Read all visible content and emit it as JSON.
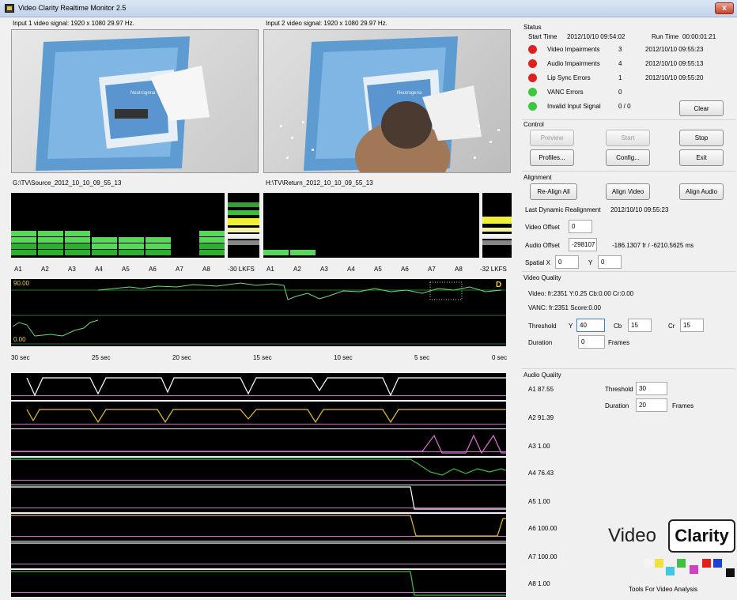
{
  "window": {
    "title": "Video Clarity Realtime Monitor 2.5",
    "close_glyph": "x"
  },
  "inputs": [
    {
      "signal_label": "Input 1 video signal: 1920 x 1080 29.97 Hz.",
      "file_path": "G:\\TV\\Source_2012_10_10_09_55_13",
      "product_text": "Neutrogena"
    },
    {
      "signal_label": "Input 2 video signal: 1920 x 1080 29.97 Hz.",
      "file_path": "H:\\TV\\Return_2012_10_10_09_55_13",
      "product_text": "Neutrogena"
    }
  ],
  "audio_meters": [
    {
      "channels": [
        "A1",
        "A2",
        "A3",
        "A4",
        "A5",
        "A6",
        "A7",
        "A8"
      ],
      "lkfs": "-30 LKFS",
      "levels": [
        0.43,
        0.43,
        0.48,
        0.35,
        0.38,
        0.33,
        0,
        0.48
      ]
    },
    {
      "channels": [
        "A1",
        "A2",
        "A3",
        "A4",
        "A5",
        "A6",
        "A7",
        "A8"
      ],
      "lkfs": "-32 LKFS",
      "levels": [
        0.07,
        0.07,
        0,
        0,
        0,
        0,
        0,
        0
      ]
    }
  ],
  "video_graph": {
    "top_value": "90.00",
    "bottom_value": "0.00",
    "marker": "D",
    "time_ticks": [
      "30 sec",
      "25 sec",
      "20 sec",
      "15 sec",
      "10 sec",
      "5 sec",
      "0 sec"
    ]
  },
  "status": {
    "heading": "Status",
    "start_time_label": "Start Time",
    "start_time_value": "2012/10/10 09:54:02",
    "run_time_label": "Run Time",
    "run_time_value": "00:00:01:21",
    "rows": [
      {
        "label": "Video Impairments",
        "count": "3",
        "time": "2012/10/10 09:55:23",
        "color": "#e02020"
      },
      {
        "label": "Audio Impairments",
        "count": "4",
        "time": "2012/10/10 09:55:13",
        "color": "#e02020"
      },
      {
        "label": "Lip Sync Errors",
        "count": "1",
        "time": "2012/10/10 09:55:20",
        "color": "#e02020"
      },
      {
        "label": "VANC Errors",
        "count": "0",
        "time": "",
        "color": "#3cc83c"
      },
      {
        "label": "Invalid Input Signal",
        "count": "0 / 0",
        "time": "",
        "color": "#3cc83c"
      }
    ],
    "clear_button": "Clear"
  },
  "control": {
    "heading": "Control",
    "preview": "Preview",
    "start": "Start",
    "stop": "Stop",
    "profiles": "Profiles...",
    "config": "Config...",
    "exit": "Exit"
  },
  "alignment": {
    "heading": "Alignment",
    "realign_all": "Re-Align All",
    "align_video": "Align Video",
    "align_audio": "Align Audio",
    "last_realign_label": "Last Dynamic Realignment",
    "last_realign_value": "2012/10/10 09:55:23",
    "video_offset_label": "Video Offset",
    "video_offset_value": "0",
    "audio_offset_label": "Audio Offset",
    "audio_offset_value": "-298107",
    "audio_offset_info": "-186.1307 fr / -6210.5625 ms",
    "spatial_x_label": "Spatial X",
    "spatial_x_value": "0",
    "y_label": "Y",
    "y_value": "0"
  },
  "video_quality": {
    "heading": "Video Quality",
    "video_line": "Video: fr:2351 Y:0.25 Cb:0.00 Cr:0.00",
    "vanc_line": "VANC: fr:2351 Score:0.00",
    "threshold_label": "Threshold",
    "y_label": "Y",
    "y_value": "40",
    "cb_label": "Cb",
    "cb_value": "15",
    "cr_label": "Cr",
    "cr_value": "15",
    "duration_label": "Duration",
    "duration_value": "0",
    "frames_label": "Frames"
  },
  "audio_quality": {
    "heading": "Audio Quality",
    "threshold_label": "Threshold",
    "threshold_value": "30",
    "duration_label": "Duration",
    "duration_value": "20",
    "frames_label": "Frames",
    "channels": [
      {
        "label": "A1 87.55",
        "color": "#ffffff"
      },
      {
        "label": "A2 91.39",
        "color": "#e8c020"
      },
      {
        "label": "A3 1.00",
        "color": "#e070d8"
      },
      {
        "label": "A4 76.43",
        "color": "#40c040"
      },
      {
        "label": "A5 1.00",
        "color": "#ffffff"
      },
      {
        "label": "A6 100.00",
        "color": "#e8c020"
      },
      {
        "label": "A7 100.00",
        "color": "#ffffff"
      },
      {
        "label": "A8 1.00",
        "color": "#40c040"
      }
    ]
  },
  "brand": {
    "word1": "Video",
    "word2": "Clarity",
    "tagline": "Tools For Video Analysis",
    "squares": [
      "#f4f4f4",
      "#f0e040",
      "#40c8e0",
      "#40c040",
      "#d040c0",
      "#e02020",
      "#2040d0",
      "#101010"
    ]
  }
}
